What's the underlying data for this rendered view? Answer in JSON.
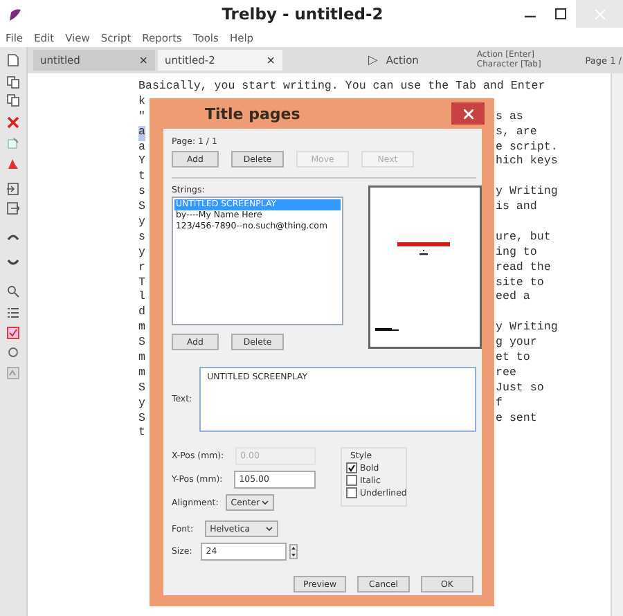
{
  "window": {
    "title": "Trelby - untitled-2"
  },
  "menu": [
    "File",
    "Edit",
    "View",
    "Script",
    "Reports",
    "Tools",
    "Help"
  ],
  "tabs": [
    {
      "label": "untitled",
      "selected": false,
      "close": "×"
    },
    {
      "label": "untitled-2",
      "selected": true,
      "close": "×"
    }
  ],
  "element_indicator": {
    "glyph": "▷",
    "label": "Action"
  },
  "hints": [
    "Action [Enter]",
    "Character [Tab]"
  ],
  "page_indicator": "Page 1 /",
  "editor": {
    "lines": [
      {
        "kind": "full",
        "text": "Basically, you start writing. You can use the Tab and Enter",
        "highlighted": false
      },
      {
        "kind": "split",
        "left": "k",
        "highlighted": false
      },
      {
        "kind": "split",
        "left": "\"",
        "right": "s as",
        "highlighted": false
      },
      {
        "kind": "split",
        "left": "a",
        "right": "s, are",
        "highlighted": true
      },
      {
        "kind": "split",
        "left": "a",
        "right": "e script.",
        "highlighted": false
      },
      {
        "kind": "split",
        "left": "Y",
        "right": "hich keys",
        "highlighted": false
      },
      {
        "kind": "split",
        "left": "t",
        "highlighted": false
      },
      {
        "kind": "split",
        "left": "s",
        "right": "y Writing",
        "highlighted": false
      },
      {
        "kind": "split",
        "left": "S",
        "right": "is and",
        "highlighted": false
      },
      {
        "kind": "split",
        "left": "y",
        "highlighted": false
      },
      {
        "kind": "split",
        "left": "s",
        "right": "ure, but",
        "highlighted": false
      },
      {
        "kind": "split",
        "left": "y",
        "right": "ing to",
        "highlighted": false
      },
      {
        "kind": "split",
        "left": "r",
        "right": "read the",
        "highlighted": false
      },
      {
        "kind": "split",
        "left": "T",
        "right": "site to",
        "highlighted": false
      },
      {
        "kind": "split",
        "left": "l",
        "right": "eed a",
        "highlighted": false
      },
      {
        "kind": "split",
        "left": "d",
        "highlighted": false
      },
      {
        "kind": "split",
        "left": "m",
        "right": "y Writing",
        "highlighted": false
      },
      {
        "kind": "split",
        "left": "S",
        "right": "g your",
        "highlighted": false
      },
      {
        "kind": "split",
        "left": "m",
        "right": "et to",
        "highlighted": false
      },
      {
        "kind": "split",
        "left": "m",
        "right": "ree",
        "highlighted": false
      },
      {
        "kind": "split",
        "left": "S",
        "right": "Just so",
        "highlighted": false
      },
      {
        "kind": "split",
        "left": "y",
        "right": "f",
        "highlighted": false
      },
      {
        "kind": "split",
        "left": "S",
        "right": "e sent",
        "highlighted": false
      },
      {
        "kind": "split",
        "left": "t",
        "highlighted": false
      }
    ]
  },
  "dialog": {
    "title": "Title pages",
    "page_label": "Page: 1 / 1",
    "page_buttons": [
      {
        "label": "Add",
        "disabled": false
      },
      {
        "label": "Delete",
        "disabled": false
      },
      {
        "label": "Move",
        "disabled": true
      },
      {
        "label": "Next",
        "disabled": true
      }
    ],
    "strings_label": "Strings:",
    "strings": [
      {
        "text": "UNTITLED SCREENPLAY",
        "selected": true
      },
      {
        "text": "by----My Name Here",
        "selected": false
      },
      {
        "text": "123/456-7890--no.such@thing.com",
        "selected": false
      }
    ],
    "string_buttons": [
      {
        "label": "Add",
        "disabled": false
      },
      {
        "label": "Delete",
        "disabled": false
      }
    ],
    "text_label": "Text:",
    "text_value": "UNTITLED SCREENPLAY",
    "x_pos": {
      "label": "X-Pos (mm):",
      "value": "0.00",
      "disabled": true
    },
    "y_pos": {
      "label": "Y-Pos (mm):",
      "value": "105.00",
      "disabled": false
    },
    "alignment": {
      "label": "Alignment:",
      "value": "Center"
    },
    "style": {
      "label": "Style",
      "options": [
        {
          "label": "Bold",
          "checked": true
        },
        {
          "label": "Italic",
          "checked": false
        },
        {
          "label": "Underlined",
          "checked": false
        }
      ]
    },
    "font": {
      "label": "Font:",
      "value": "Helvetica"
    },
    "size": {
      "label": "Size:",
      "value": "24"
    },
    "buttons": [
      "Preview",
      "Cancel",
      "OK"
    ]
  }
}
